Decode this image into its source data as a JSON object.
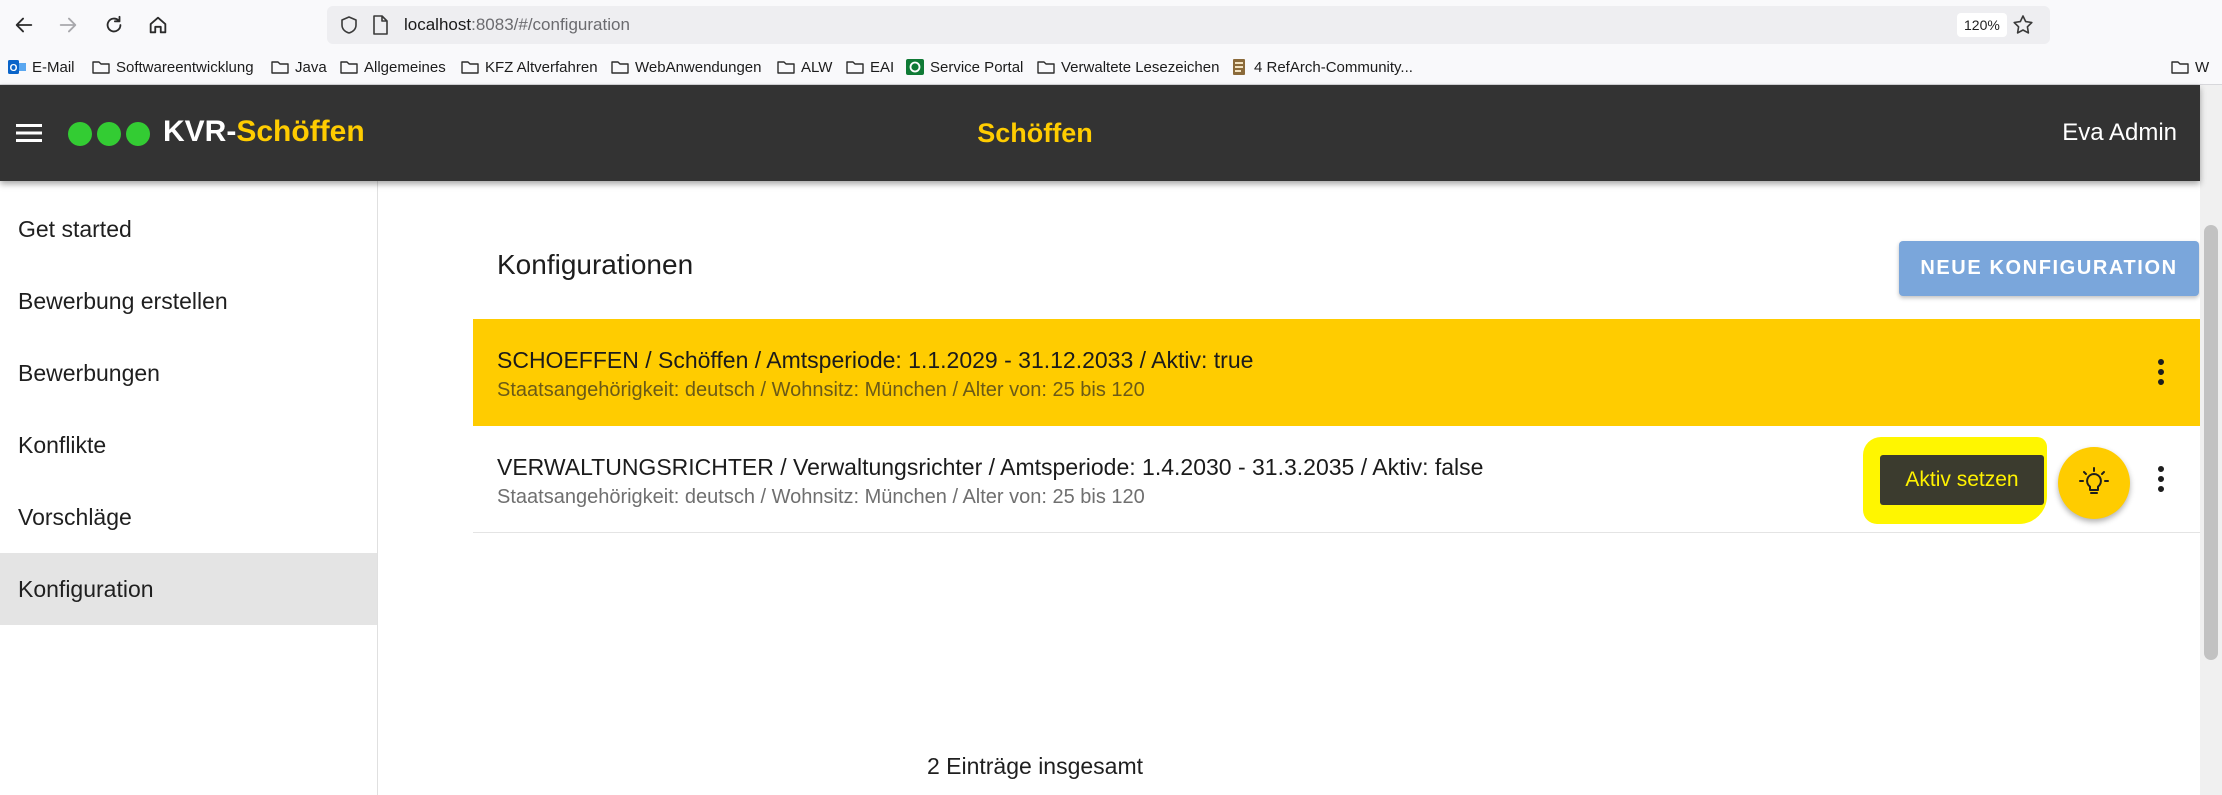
{
  "browser": {
    "url_host": "localhost",
    "url_rest": ":8083/#/configuration",
    "zoom": "120%",
    "bookmarks": [
      {
        "label": "E-Mail",
        "icon": "outlook-icon"
      },
      {
        "label": "Softwareentwicklung",
        "icon": "folder-icon"
      },
      {
        "label": "Java",
        "icon": "folder-icon"
      },
      {
        "label": "Allgemeines",
        "icon": "folder-icon"
      },
      {
        "label": "KFZ Altverfahren",
        "icon": "folder-icon"
      },
      {
        "label": "WebAnwendungen",
        "icon": "folder-icon"
      },
      {
        "label": "ALW",
        "icon": "folder-icon"
      },
      {
        "label": "EAI",
        "icon": "folder-icon"
      },
      {
        "label": "Service Portal",
        "icon": "service-portal-icon"
      },
      {
        "label": "Verwaltete Lesezeichen",
        "icon": "folder-icon"
      },
      {
        "label": "4 RefArch-Community...",
        "icon": "document-icon"
      },
      {
        "label": "W",
        "icon": "folder-icon"
      }
    ]
  },
  "app": {
    "brand_prefix": "KVR-",
    "brand_suffix": "Schöffen",
    "title": "Schöffen",
    "user": "Eva Admin",
    "colors": {
      "appbar": "#333333",
      "accent": "#ffcc00",
      "logo_dots": "#33cc33",
      "primary_button": "#7aa6db"
    }
  },
  "sidebar": {
    "items": [
      {
        "label": "Get started"
      },
      {
        "label": "Bewerbung erstellen"
      },
      {
        "label": "Bewerbungen"
      },
      {
        "label": "Konflikte"
      },
      {
        "label": "Vorschläge"
      },
      {
        "label": "Konfiguration",
        "active": true
      }
    ]
  },
  "main": {
    "heading": "Konfigurationen",
    "new_button": "NEUE KONFIGURATION",
    "rows": [
      {
        "title": "SCHOEFFEN / Schöffen / Amtsperiode: 1.1.2029 - 31.12.2033 / Aktiv: true",
        "subtitle": "Staatsangehörigkeit: deutsch / Wohnsitz: München / Alter von: 25 bis 120",
        "active": true
      },
      {
        "title": "VERWALTUNGSRICHTER / Verwaltungsrichter / Amtsperiode: 1.4.2030 - 31.3.2035 / Aktiv: false",
        "subtitle": "Staatsangehörigkeit: deutsch / Wohnsitz: München / Alter von: 25 bis 120",
        "active": false,
        "tooltip": "Aktiv setzen"
      }
    ],
    "total": "2 Einträge insgesamt"
  }
}
